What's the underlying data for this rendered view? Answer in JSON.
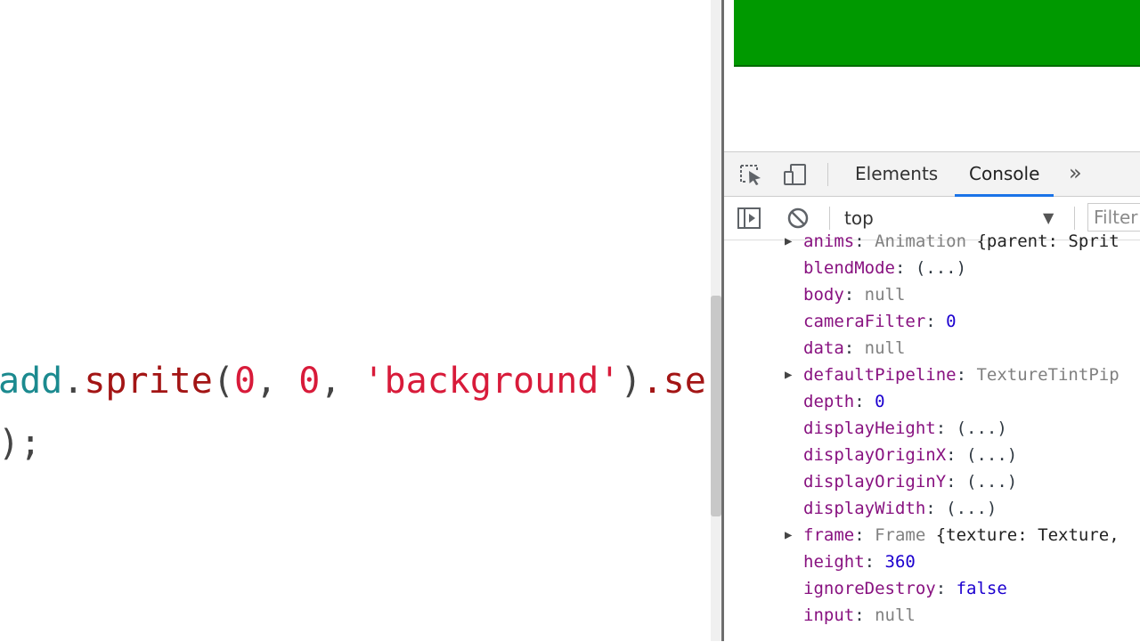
{
  "editor": {
    "line1": {
      "method_prefix": "add",
      "dot": ".",
      "fn": "sprite",
      "open": "(",
      "arg1": "0",
      "comma1": ", ",
      "arg2": "0",
      "comma2": ", ",
      "arg3": "'background'",
      "close": ")",
      "tail": ".se"
    },
    "line2": {
      "text": ");"
    }
  },
  "viewport": {
    "canvas_color": "#009900"
  },
  "devtools": {
    "tabs": [
      {
        "label": "Elements"
      },
      {
        "label": "Console"
      }
    ],
    "more_tabs": "»",
    "toolbar": {
      "context": "top",
      "context_caret": "▼",
      "filter_placeholder": "Filter"
    },
    "properties": [
      {
        "key": "anims",
        "expandable": true,
        "type": "Animation",
        "preview": " {parent: Sprit"
      },
      {
        "key": "blendMode",
        "expandable": false,
        "value": "(...)"
      },
      {
        "key": "body",
        "expandable": false,
        "value": "null"
      },
      {
        "key": "cameraFilter",
        "expandable": false,
        "value": "0"
      },
      {
        "key": "data",
        "expandable": false,
        "value": "null"
      },
      {
        "key": "defaultPipeline",
        "expandable": true,
        "type": "TextureTintPip"
      },
      {
        "key": "depth",
        "expandable": false,
        "value": "0"
      },
      {
        "key": "displayHeight",
        "expandable": false,
        "value": "(...)"
      },
      {
        "key": "displayOriginX",
        "expandable": false,
        "value": "(...)"
      },
      {
        "key": "displayOriginY",
        "expandable": false,
        "value": "(...)"
      },
      {
        "key": "displayWidth",
        "expandable": false,
        "value": "(...)"
      },
      {
        "key": "frame",
        "expandable": true,
        "type": "Frame",
        "preview": " {texture: Texture,"
      },
      {
        "key": "height",
        "expandable": false,
        "value": "360"
      },
      {
        "key": "ignoreDestroy",
        "expandable": false,
        "value": "false"
      },
      {
        "key": "input",
        "expandable": false,
        "value": "null"
      }
    ],
    "colors": {
      "key": "#881280",
      "number": "#1c00cf",
      "null": "#808080",
      "active_tab_underline": "#1a73e8"
    }
  }
}
